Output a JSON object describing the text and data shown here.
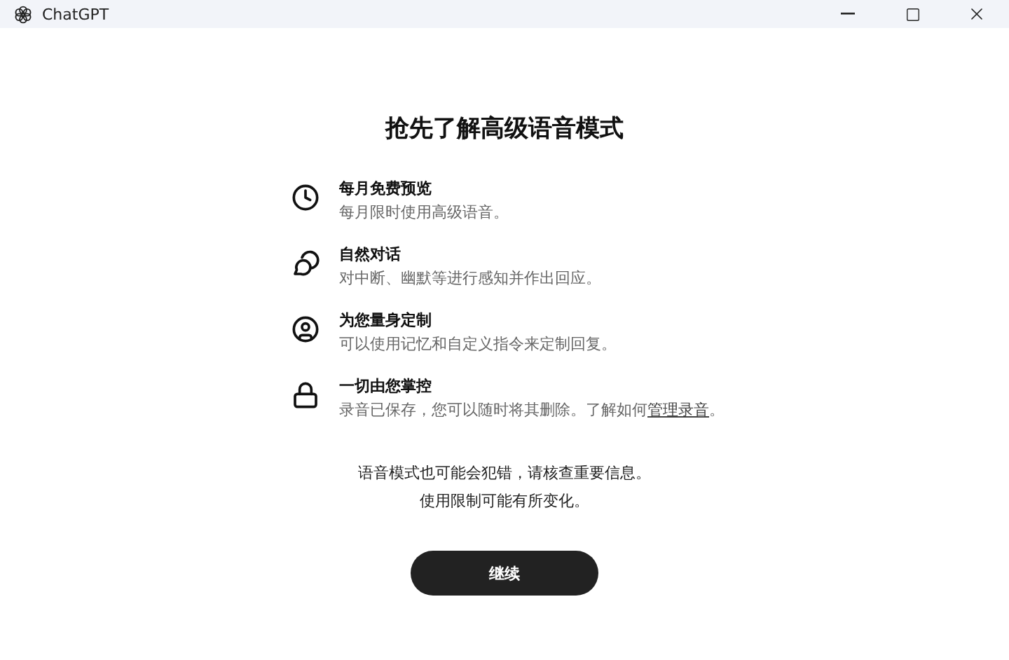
{
  "window": {
    "title": "ChatGPT"
  },
  "heading": "抢先了解高级语音模式",
  "features": [
    {
      "kind": "clock",
      "title": "每月免费预览",
      "description": "每月限时使用高级语音。"
    },
    {
      "kind": "chat",
      "title": "自然对话",
      "description": "对中断、幽默等进行感知并作出回应。"
    },
    {
      "kind": "person",
      "title": "为您量身定制",
      "description": "可以使用记忆和自定义指令来定制回复。"
    },
    {
      "kind": "lock",
      "title": "一切由您掌控",
      "description": "录音已保存，您可以随时将其删除。了解如何",
      "link": "管理录音",
      "after": "。"
    }
  ],
  "notice": [
    "语音模式也可能会犯错，请核查重要信息。",
    "使用限制可能有所变化。"
  ],
  "continue_button": "继续"
}
